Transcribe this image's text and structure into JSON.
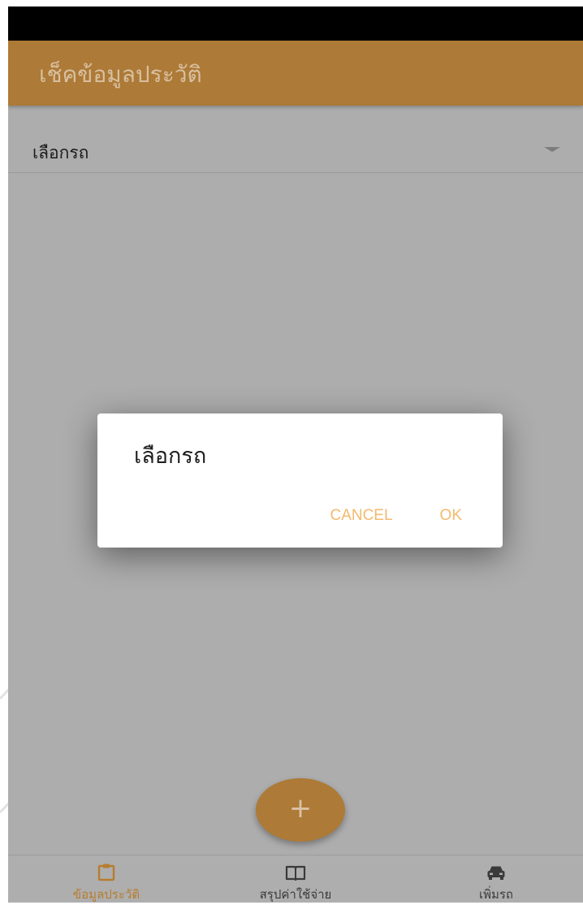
{
  "app_bar": {
    "title": "เช็คข้อมูลประวัติ"
  },
  "car_select": {
    "label": "เลือกรถ"
  },
  "dialog": {
    "title": "เลือกรถ",
    "cancel_label": "CANCEL",
    "ok_label": "OK"
  },
  "fab": {
    "icon": "plus-icon",
    "label": "+"
  },
  "bottom_nav": {
    "items": [
      {
        "label": "ข้อมูลประวัติ",
        "icon": "clipboard-icon",
        "active": true
      },
      {
        "label": "สรุปค่าใช้จ่าย",
        "icon": "book-icon",
        "active": false
      },
      {
        "label": "เพิ่มรถ",
        "icon": "car-icon",
        "active": false
      }
    ]
  },
  "colors": {
    "primary": "#ad7a37",
    "accent": "#f3ba6e",
    "scrim_background": "#adadad"
  }
}
